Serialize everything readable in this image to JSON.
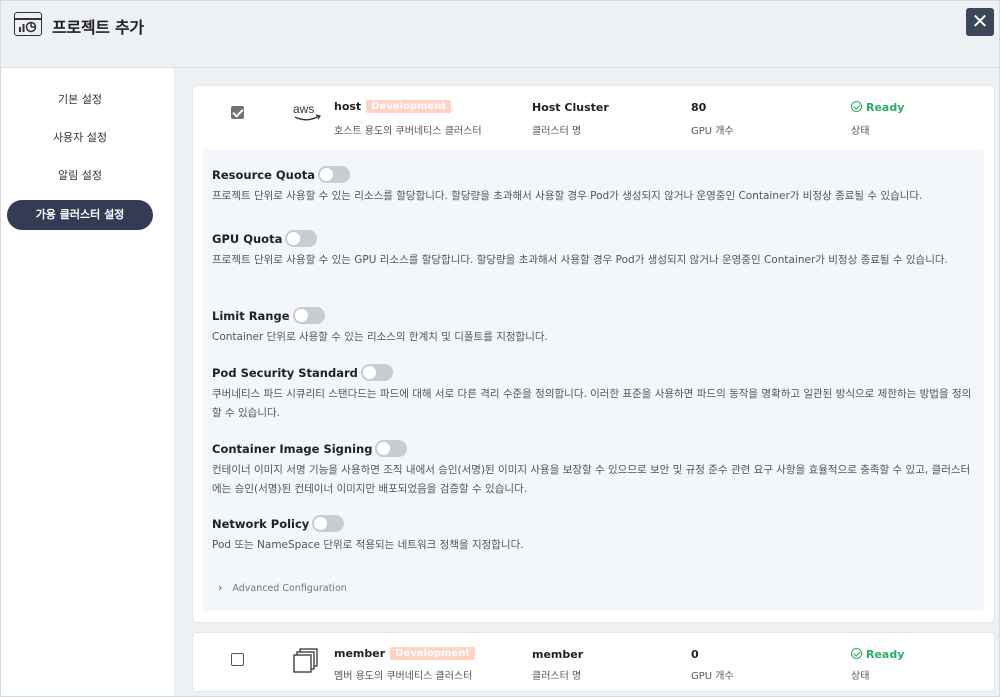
{
  "header": {
    "title": "프로젝트 추가",
    "close_glyph": "✕",
    "icon": "dashboard-window-icon"
  },
  "sidebar": {
    "items": [
      {
        "label": "기본 설정",
        "active": false
      },
      {
        "label": "사용자 설정",
        "active": false
      },
      {
        "label": "알림 설정",
        "active": false
      },
      {
        "label": "가용 클러스터 설정",
        "active": true
      }
    ]
  },
  "clusters": [
    {
      "checked": true,
      "logo": "aws-icon",
      "name": "host",
      "badge": "Development",
      "description": "호스트 용도의 쿠버네티스 클러스터",
      "cluster_label": "Host Cluster",
      "cluster_label_caption": "클러스터 명",
      "gpu": "80",
      "gpu_caption": "GPU 개수",
      "status": "Ready",
      "status_caption": "상태"
    },
    {
      "checked": false,
      "logo": "cluster-windows-icon",
      "name": "member",
      "badge": "Development",
      "description": "멤버 용도의 쿠버네티스 클러스터",
      "cluster_label": "member",
      "cluster_label_caption": "클러스터 명",
      "gpu": "0",
      "gpu_caption": "GPU 개수",
      "status": "Ready",
      "status_caption": "상태"
    }
  ],
  "options": [
    {
      "title": "Resource Quota",
      "enabled": false,
      "description": "프로젝트 단위로 사용할 수 있는 리소스를 할당합니다. 할당량을 초과해서 사용할 경우 Pod가 생성되지 않거나 운영중인 Container가 비정상 종료될 수 있습니다."
    },
    {
      "title": "GPU Quota",
      "enabled": false,
      "description": "프로젝트 단위로 사용할 수 있는 GPU 리소스를 할당합니다. 할당량을 초과해서 사용할 경우 Pod가 생성되지 않거나 운영중인 Container가 비정상 종료될 수 있습니다."
    },
    {
      "title": "Limit Range",
      "enabled": false,
      "description": "Container 단위로 사용할 수 있는 리소스의 한계치 및 디폴트를 지정합니다."
    },
    {
      "title": "Pod Security Standard",
      "enabled": false,
      "description": "쿠버네티스 파드 시큐리티 스탠다드는 파드에 대해 서로 다른 격리 수준을 정의합니다. 이러한 표준을 사용하면 파드의 동작을 명확하고 일관된 방식으로 제한하는 방법을 정의할 수 있습니다."
    },
    {
      "title": "Container Image Signing",
      "enabled": false,
      "description": "컨테이너 이미지 서명 기능을 사용하면 조직 내에서 승인(서명)된 이미지 사용을 보장할 수 있으므로 보안 및 규정 준수 관련 요구 사항을 효율적으로 충족할 수 있고, 클러스터에는 승인(서명)된 컨테이너 이미지만 배포되었음을 검증할 수 있습니다."
    },
    {
      "title": "Network Policy",
      "enabled": false,
      "description": "Pod 또는 NameSpace 단위로 적용되는 네트워크 정책을 지정합니다."
    }
  ],
  "advanced": {
    "label": "Advanced Configuration",
    "chevron": "›"
  },
  "colors": {
    "sidebar_active": "#343c55",
    "close_button": "#3d4559",
    "badge": "#ffd2c2",
    "ready": "#27ae60",
    "toggle_off": "#c9ccd1"
  }
}
